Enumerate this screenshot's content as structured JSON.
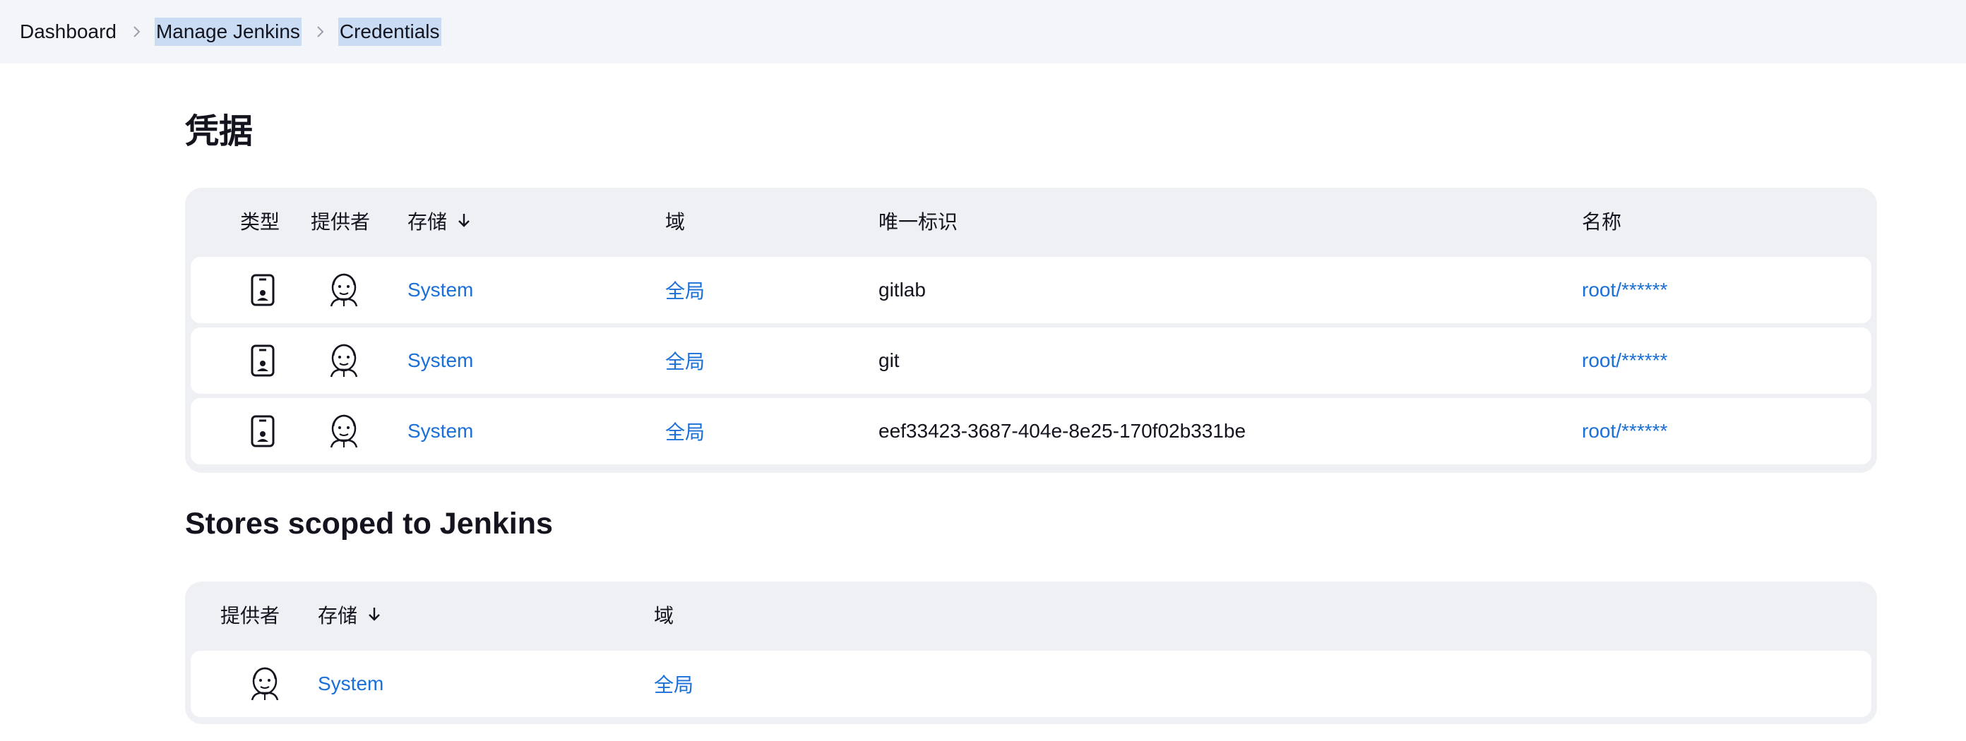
{
  "breadcrumb": {
    "items": [
      "Dashboard",
      "Manage Jenkins",
      "Credentials"
    ]
  },
  "page_title": "凭据",
  "credentials_table": {
    "headers": {
      "type": "类型",
      "provider": "提供者",
      "store": "存储",
      "domain": "域",
      "id": "唯一标识",
      "name": "名称"
    },
    "rows": [
      {
        "type_icon": "mobile-badge-icon",
        "provider_icon": "jenkins-icon",
        "store": "System",
        "domain": "全局",
        "id": "gitlab",
        "name": "root/******"
      },
      {
        "type_icon": "mobile-badge-icon",
        "provider_icon": "jenkins-icon",
        "store": "System",
        "domain": "全局",
        "id": "git",
        "name": "root/******"
      },
      {
        "type_icon": "mobile-badge-icon",
        "provider_icon": "jenkins-icon",
        "store": "System",
        "domain": "全局",
        "id": "eef33423-3687-404e-8e25-170f02b331be",
        "name": "root/******"
      }
    ]
  },
  "stores_section": {
    "title": "Stores scoped to Jenkins",
    "headers": {
      "provider": "提供者",
      "store": "存储",
      "domain": "域"
    },
    "rows": [
      {
        "provider_icon": "jenkins-icon",
        "store": "System",
        "domain": "全局"
      }
    ]
  },
  "colors": {
    "link": "#1a6fd8",
    "header_bg": "#f4f5f8",
    "card_bg": "#eef0f4",
    "selection": "#c9dcf3"
  }
}
